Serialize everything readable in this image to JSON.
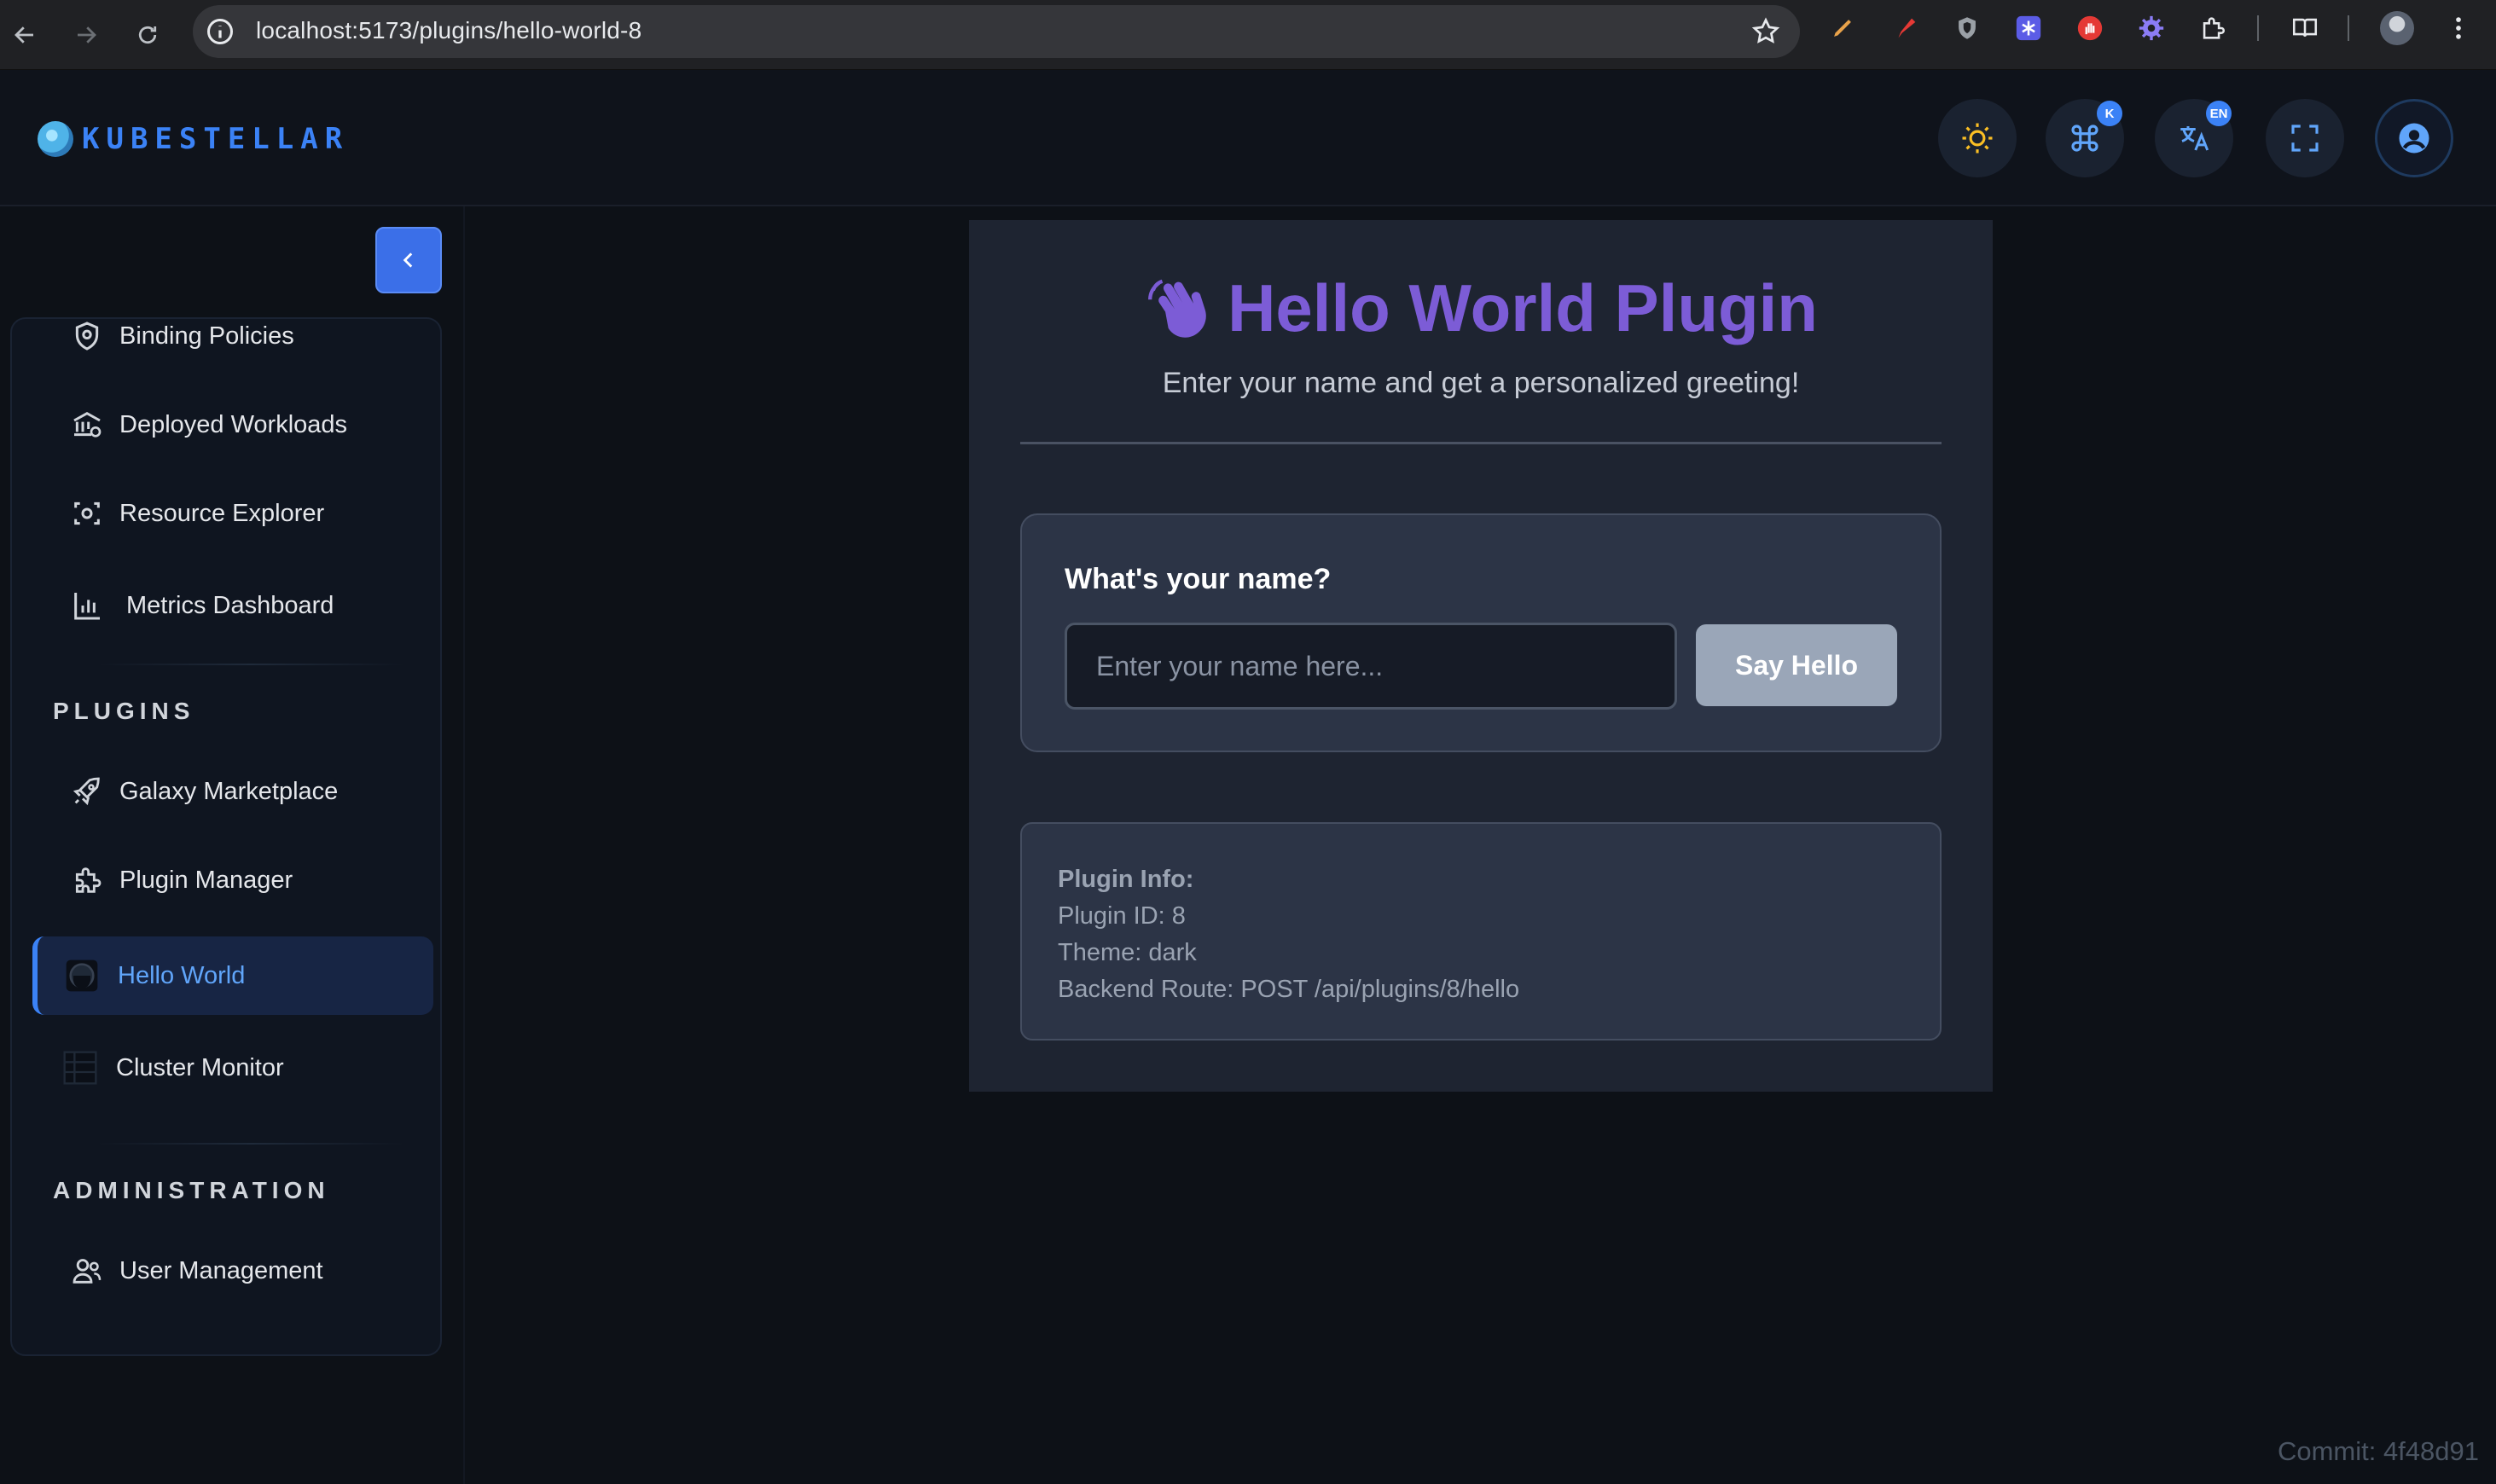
{
  "browser": {
    "url": "localhost:5173/plugins/hello-world-8"
  },
  "header": {
    "logo_text": "KUBESTELLAR",
    "badges": {
      "command": "K",
      "language": "EN"
    }
  },
  "sidebar": {
    "items_top": [
      {
        "label": "Binding Policies",
        "icon": "shield-icon"
      },
      {
        "label": "Deployed Workloads",
        "icon": "building-icon"
      },
      {
        "label": "Resource Explorer",
        "icon": "scan-icon"
      },
      {
        "label": "Metrics Dashboard",
        "icon": "bar-chart-icon"
      }
    ],
    "section_plugins": "PLUGINS",
    "items_plugins": [
      {
        "label": "Galaxy Marketplace",
        "icon": "rocket-icon"
      },
      {
        "label": "Plugin Manager",
        "icon": "puzzle-icon"
      },
      {
        "label": "Hello World",
        "icon": "plugin-icon",
        "active": true
      },
      {
        "label": "Cluster Monitor",
        "icon": "grid-icon"
      }
    ],
    "section_admin": "ADMINISTRATION",
    "items_admin": [
      {
        "label": "User Management",
        "icon": "users-icon"
      }
    ]
  },
  "plugin": {
    "title": "Hello World Plugin",
    "subtitle": "Enter your name and get a personalized greeting!",
    "name_question": "What's your name?",
    "name_placeholder": "Enter your name here...",
    "name_value": "",
    "button_label": "Say Hello",
    "info": {
      "heading": "Plugin Info:",
      "plugin_id": "Plugin ID: 8",
      "theme": "Theme: dark",
      "route": "Backend Route: POST /api/plugins/8/hello"
    }
  },
  "footer": {
    "commit": "Commit: 4f48d91"
  },
  "colors": {
    "accent": "#3b82f6",
    "title_purple": "#7c5cd6",
    "background": "#0d1117"
  }
}
